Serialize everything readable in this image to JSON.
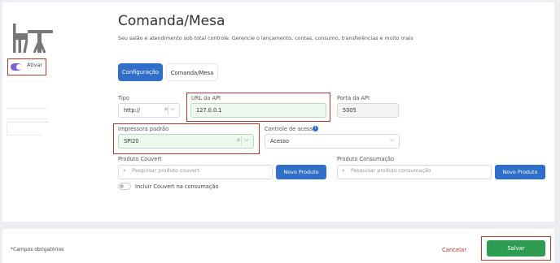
{
  "sidebar": {
    "toggle": {
      "label": "Ativar",
      "checked": true
    },
    "icon": "chair-table-icon"
  },
  "header": {
    "title": "Comanda/Mesa",
    "subtitle": "Seu salão e atendimento sob total controle. Gerencie o lançamento, contas, consumo, transferências e muito mais"
  },
  "tabs": [
    {
      "label": "Configuração",
      "active": true
    },
    {
      "label": "Comanda/Mesa",
      "active": false
    }
  ],
  "form": {
    "tipo": {
      "label": "Tipo",
      "value": "http://"
    },
    "url_api": {
      "label": "URL da API",
      "value": "127.0.0.1"
    },
    "porta_api": {
      "label": "Porta da API",
      "value": "5005"
    },
    "impressora": {
      "label": "Impressora padrão",
      "value": "SPI20"
    },
    "controle_acesso": {
      "label": "Controle de acesso",
      "value": "Acesso"
    },
    "produto_couvert": {
      "label": "Produto Couvert",
      "placeholder": "Pesquisar produto couvert",
      "button": "Novo Produto"
    },
    "produto_consumacao": {
      "label": "Produto Consumação",
      "placeholder": "Pesquisar produto consumação",
      "button": "Novo Produto"
    },
    "incluir_couvert": {
      "label": "Incluir Couvert na consumação",
      "checked": false
    }
  },
  "footer": {
    "required_note": "*Campos obrigatórios",
    "cancel_label": "Cancelar",
    "save_label": "Salvar"
  },
  "colors": {
    "primary": "#2f6ec9",
    "success": "#2e9b52",
    "danger": "#b23a26",
    "accent": "#7b61d9"
  }
}
